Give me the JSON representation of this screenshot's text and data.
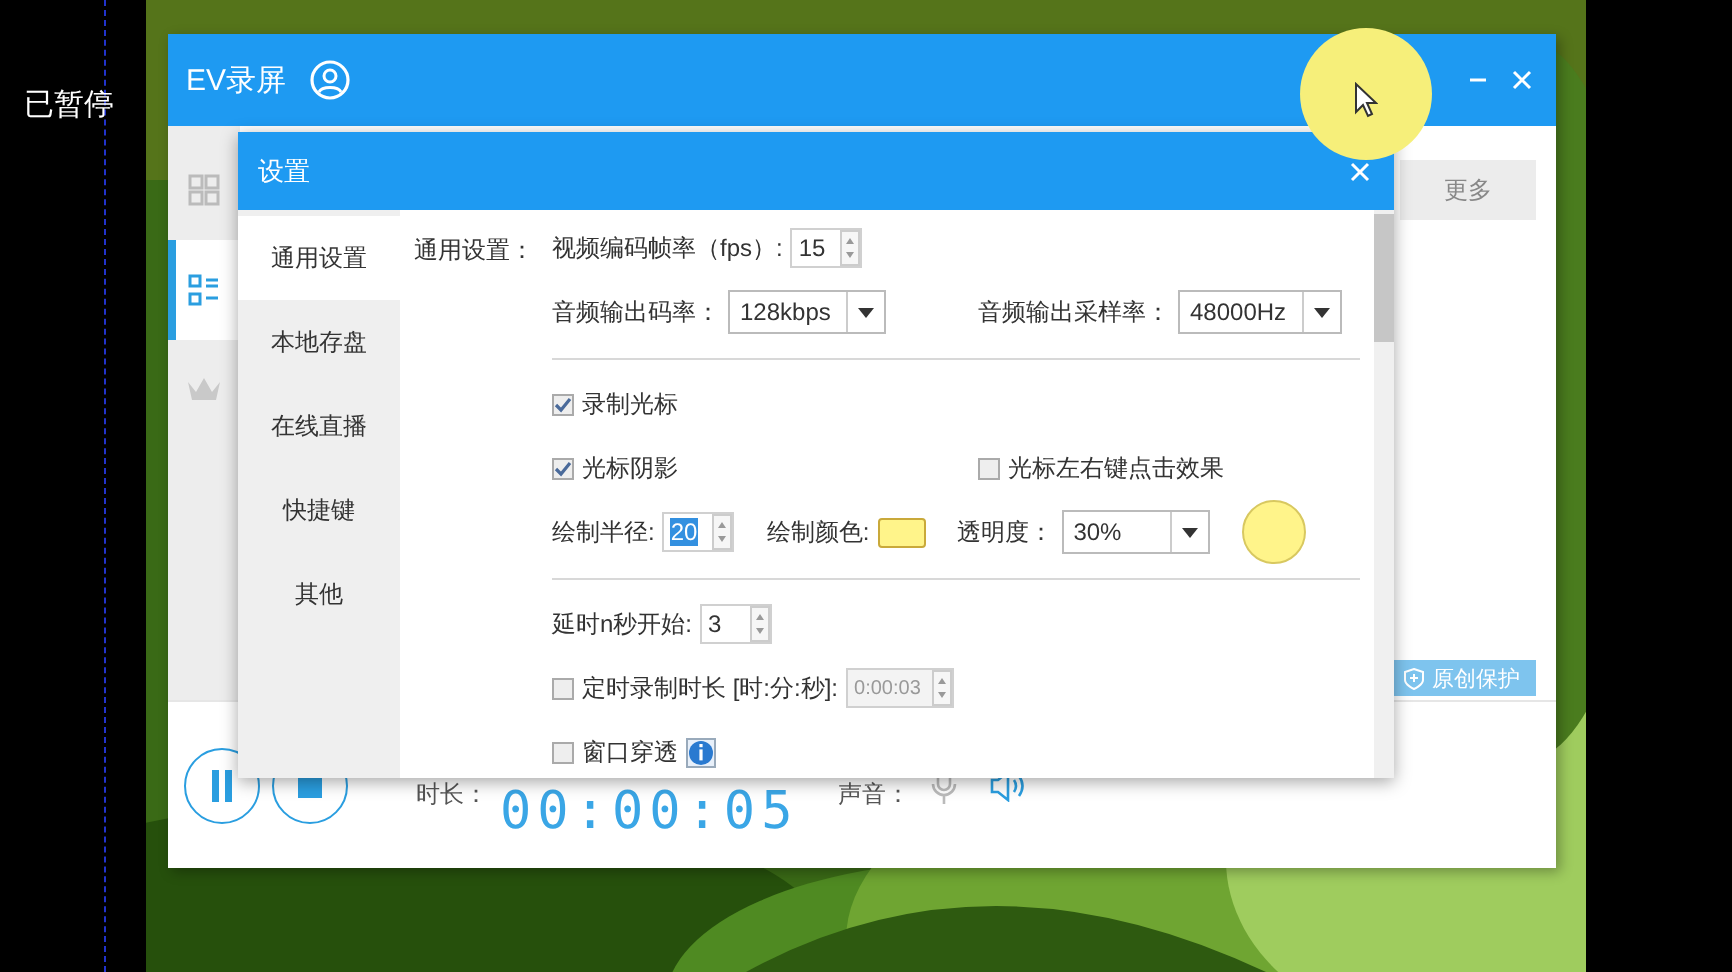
{
  "desktop": {
    "status_text": "已暂停"
  },
  "app": {
    "title": "EV录屏",
    "sidebar": [
      {
        "selected": false
      },
      {
        "selected": true
      },
      {
        "selected": false
      }
    ],
    "tabs": [
      {
        "label": "更多"
      }
    ],
    "protect_button": "原创保护",
    "duration_label": "时长：",
    "duration": "00:00:05",
    "sound_label": "声音："
  },
  "dialog": {
    "title": "设置",
    "nav": [
      {
        "label": "通用设置",
        "selected": true
      },
      {
        "label": "本地存盘",
        "selected": false
      },
      {
        "label": "在线直播",
        "selected": false
      },
      {
        "label": "快捷键",
        "selected": false
      },
      {
        "label": "其他",
        "selected": false
      }
    ],
    "sections": [
      {
        "label": "通用设置：",
        "rows": [
          {
            "items": [
              {
                "kind": "spinner",
                "label": "视频编码帧率（fps）:",
                "value": "15",
                "highlighted": false,
                "disabled": false
              }
            ]
          },
          {
            "items": [
              {
                "kind": "select",
                "label": "音频输出码率：",
                "value": "128kbps"
              },
              {
                "kind": "select",
                "label": "音频输出采样率：",
                "value": "48000Hz"
              }
            ]
          }
        ]
      },
      {
        "rows": [
          {
            "items": [
              {
                "kind": "checkbox",
                "label": "录制光标",
                "checked": true
              }
            ]
          },
          {
            "items": [
              {
                "kind": "checkbox",
                "label": "光标阴影",
                "checked": true
              },
              {
                "kind": "checkbox",
                "label": "光标左右键点击效果",
                "checked": false
              }
            ]
          },
          {
            "items": [
              {
                "kind": "spinner",
                "label": "绘制半径:",
                "value": "20",
                "highlighted": true,
                "disabled": false
              },
              {
                "kind": "color",
                "label": "绘制颜色:",
                "color": "#fff48a"
              },
              {
                "kind": "select",
                "label": "透明度：",
                "value": "30%"
              },
              {
                "kind": "preview"
              }
            ]
          }
        ]
      },
      {
        "rows": [
          {
            "items": [
              {
                "kind": "spinner",
                "label": "延时n秒开始:",
                "value": "3",
                "highlighted": false,
                "disabled": false
              }
            ]
          },
          {
            "items": [
              {
                "kind": "checkbox",
                "label": "定时录制时长 [时:分:秒]:",
                "checked": false,
                "spinner": {
                  "value": "0:00:03",
                  "disabled": true
                }
              }
            ]
          },
          {
            "items": [
              {
                "kind": "checkbox",
                "label": "窗口穿透",
                "checked": false,
                "info": true
              }
            ]
          }
        ]
      }
    ]
  }
}
